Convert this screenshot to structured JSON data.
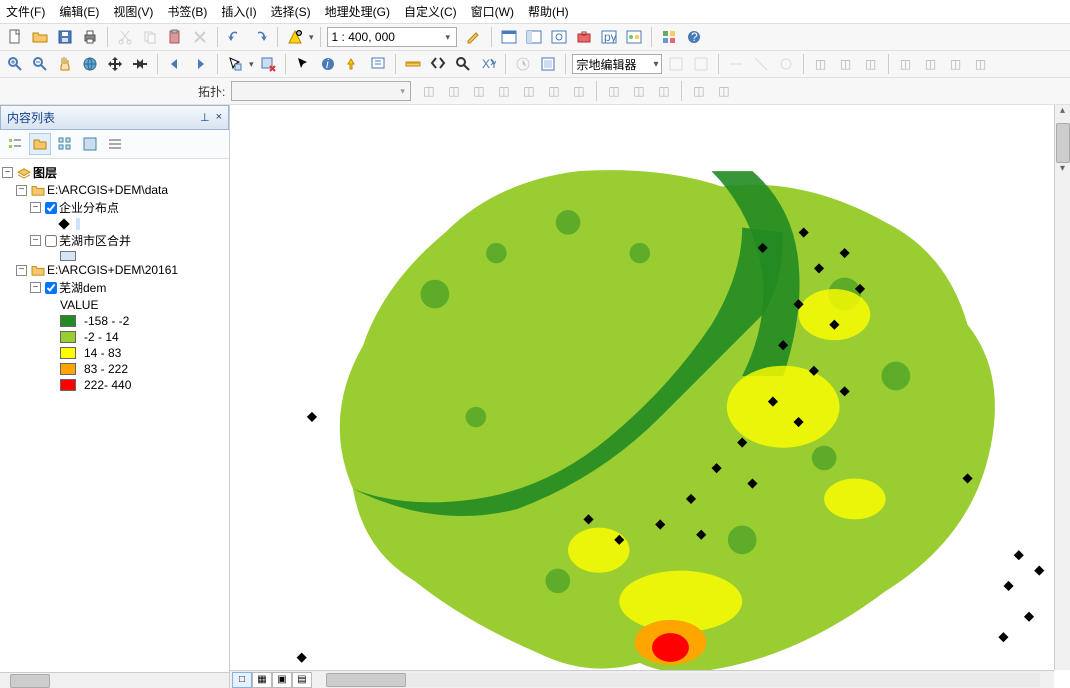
{
  "menu": {
    "file": "文件(F)",
    "edit": "编辑(E)",
    "view": "视图(V)",
    "bookmarks": "书签(B)",
    "insert": "插入(I)",
    "selection": "选择(S)",
    "geoprocessing": "地理处理(G)",
    "customize": "自定义(C)",
    "window": "窗口(W)",
    "help": "帮助(H)"
  },
  "scale": "1 : 400, 000",
  "parcel_editor": "宗地编辑器",
  "topo_label": "拓扑:",
  "toc": {
    "title": "内容列表",
    "pin": "⊥",
    "close": "×",
    "root": "图层",
    "group1": "E:\\ARCGIS+DEM\\data",
    "layer_points": "企业分布点",
    "layer_city": "芜湖市区合并",
    "group2": "E:\\ARCGIS+DEM\\20161",
    "layer_dem": "芜湖dem",
    "value_header": "VALUE",
    "classes": [
      {
        "label": "-158 - -2",
        "color": "#228B22"
      },
      {
        "label": "-2 - 14",
        "color": "#9ACD32"
      },
      {
        "label": "14 - 83",
        "color": "#FFFF00"
      },
      {
        "label": "83 - 222",
        "color": "#FFA500"
      },
      {
        "label": "222- 440",
        "color": "#FF0000"
      }
    ]
  },
  "map_tabs": [
    "□",
    "▦",
    "▣",
    "▤"
  ]
}
